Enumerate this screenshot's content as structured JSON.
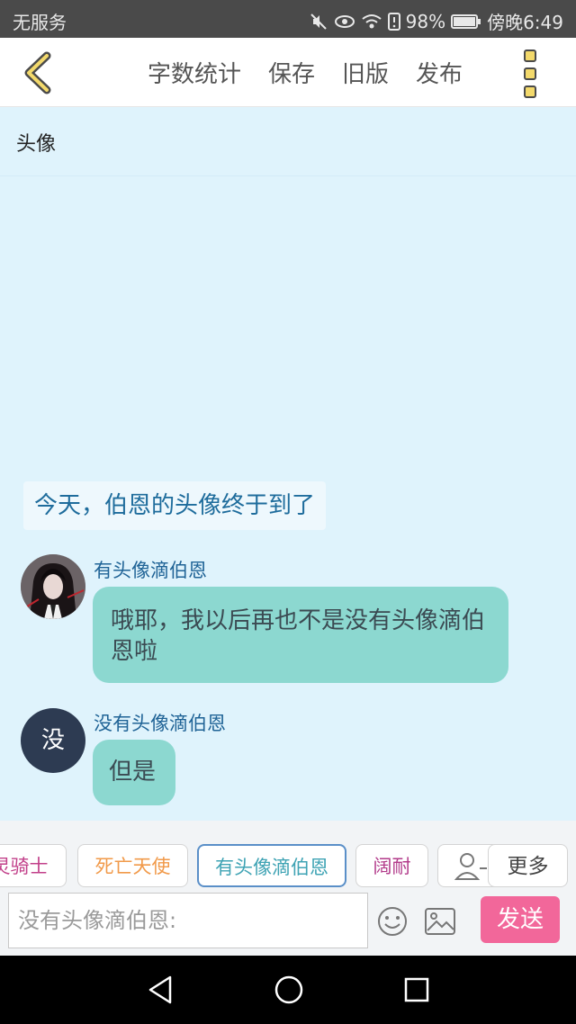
{
  "status_bar": {
    "carrier": "无服务",
    "battery": "98%",
    "time": "傍晚6:49",
    "icons": [
      "mute-icon",
      "eye-icon",
      "wifi-icon",
      "sim-icon",
      "battery-icon"
    ]
  },
  "toolbar": {
    "back_icon": "chevron-left-icon",
    "word_count": "字数统计",
    "save": "保存",
    "old_version": "旧版",
    "publish": "发布",
    "more_icon": "more-vertical-icon"
  },
  "title_field": "头像",
  "story": {
    "narration": "今天，伯恩的头像终于到了",
    "messages": [
      {
        "speaker": "有头像滴伯恩",
        "text": "哦耶，我以后再也不是没有头像滴伯恩啦",
        "avatar": "image"
      },
      {
        "speaker": "没有头像滴伯恩",
        "text": "但是",
        "avatar_text": "没"
      }
    ]
  },
  "characters": {
    "items": [
      "灵骑士",
      "死亡天使",
      "有头像滴伯恩",
      "阔耐"
    ],
    "active": "有头像滴伯恩",
    "add_icon": "add-person-icon",
    "more_label": "更多"
  },
  "composer": {
    "placeholder": "没有头像滴伯恩:",
    "emoji_icon": "smiley-icon",
    "image_icon": "image-icon",
    "send_label": "发送"
  },
  "nav_bar": [
    "back-triangle-icon",
    "home-circle-icon",
    "recents-square-icon"
  ],
  "colors": {
    "background": "#dff3fc",
    "bubble": "#8cd8d0",
    "narration_text": "#1e6c9c",
    "send_button": "#f2679a",
    "accent_yellow": "#f3d96b"
  }
}
